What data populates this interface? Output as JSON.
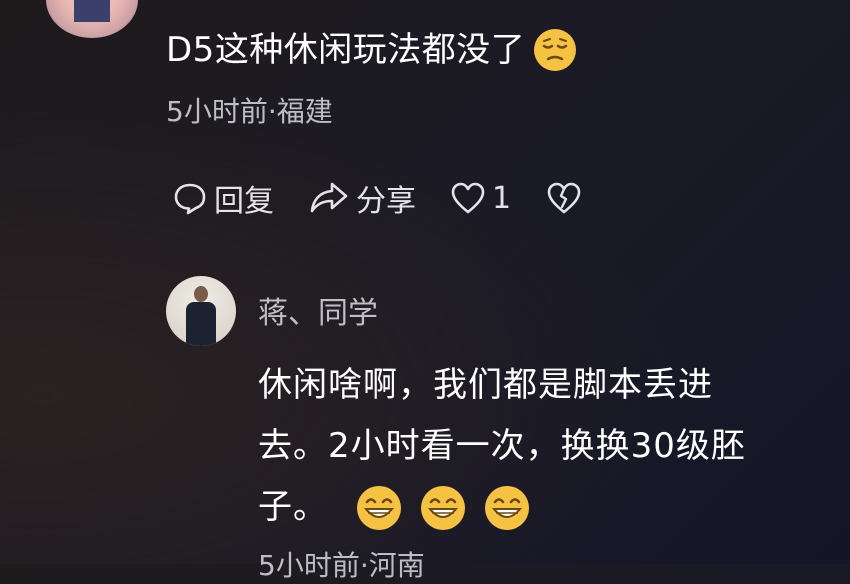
{
  "comment": {
    "text": "D5这种休闲玩法都没了",
    "meta": "5小时前·福建",
    "emoji": "pensive-face-emoji"
  },
  "actions": {
    "reply_label": "回复",
    "share_label": "分享",
    "like_count": "1"
  },
  "reply": {
    "author": "蒋、同学",
    "lines": [
      "休闲啥啊，我们都是脚本丢进",
      "去。2小时看一次，换换30级胚",
      "子。"
    ],
    "emoji_count": 3,
    "emoji": "grinning-face-emoji",
    "meta": "5小时前·河南"
  },
  "colors": {
    "text": "#ffffff",
    "meta": "#bdbdc6",
    "emoji": "#f6c244"
  }
}
